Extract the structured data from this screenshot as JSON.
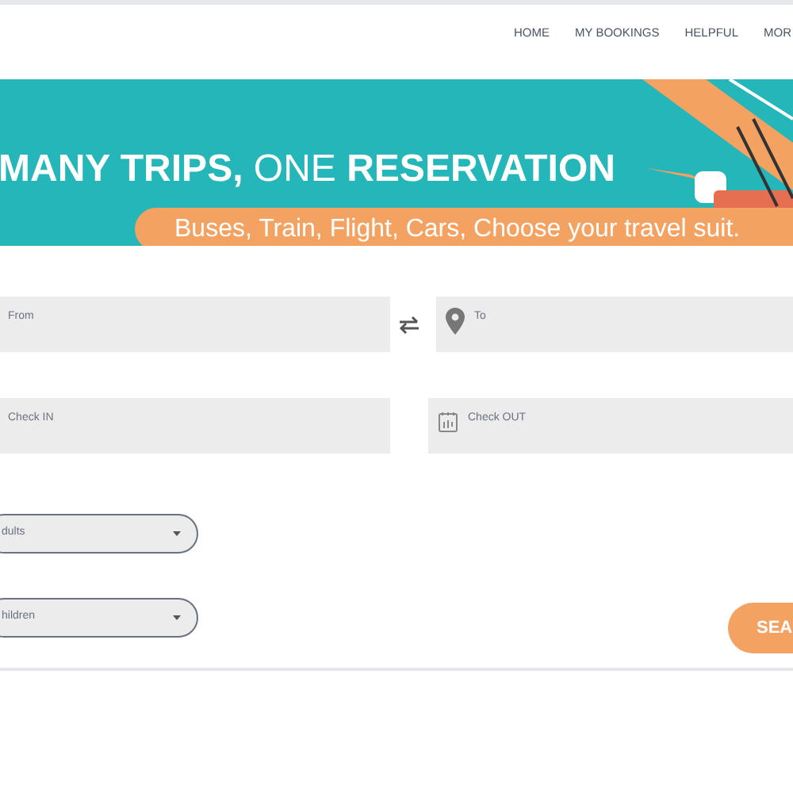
{
  "nav": [
    {
      "label": "HOME"
    },
    {
      "label": "MY BOOKINGS"
    },
    {
      "label": "HELPFUL"
    },
    {
      "label": "MOR"
    }
  ],
  "banner": {
    "heading": "**MANY TRIPS,** ONE **RESERVATION**",
    "tagline": "Buses, Train, Flight, Cars, Choose your travel suit."
  },
  "search_form": {
    "from": {
      "placeholder": "From"
    },
    "to": {
      "placeholder": "To"
    },
    "check_in": {
      "placeholder": "Check IN"
    },
    "check_out": {
      "placeholder": "Check OUT"
    },
    "adults": {
      "value": "dults"
    },
    "children": {
      "value": "hildren"
    },
    "search_button": "SEA"
  }
}
